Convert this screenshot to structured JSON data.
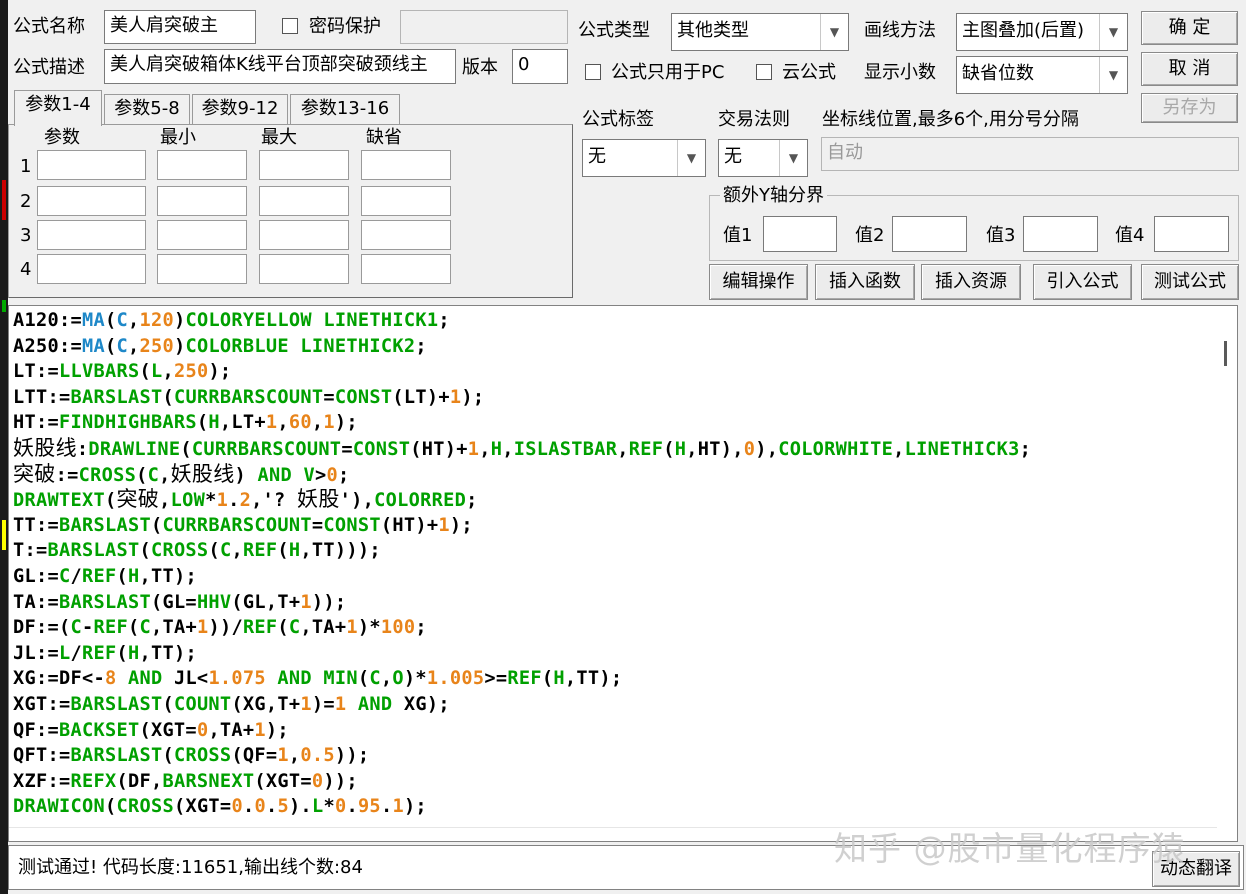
{
  "labels": {
    "formula_name": "公式名称",
    "password_protect": "密码保护",
    "formula_desc": "公式描述",
    "version": "版本",
    "formula_type": "公式类型",
    "draw_method": "画线方法",
    "pc_only": "公式只用于PC",
    "cloud_formula": "云公式",
    "show_decimal": "显示小数",
    "formula_tag": "公式标签",
    "trade_rule": "交易法则",
    "coord_position": "坐标线位置,最多6个,用分号分隔",
    "extra_y_axis": "额外Y轴分界",
    "val1": "值1",
    "val2": "值2",
    "val3": "值3",
    "val4": "值4"
  },
  "fields": {
    "formula_name": "美人肩突破主",
    "password": "",
    "formula_desc": "美人肩突破箱体K线平台顶部突破颈线主",
    "version": "0",
    "formula_type": "其他类型",
    "draw_method": "主图叠加(后置)",
    "decimal_places": "缺省位数",
    "formula_tag": "无",
    "trade_rule": "无",
    "coord_position": "自动"
  },
  "buttons": {
    "ok": "确  定",
    "cancel": "取  消",
    "save_as": "另存为",
    "edit_ops": "编辑操作",
    "insert_func": "插入函数",
    "insert_resource": "插入资源",
    "import_formula": "引入公式",
    "test_formula": "测试公式",
    "dynamic_translate": "动态翻译"
  },
  "tabs": [
    "参数1-4",
    "参数5-8",
    "参数9-12",
    "参数13-16"
  ],
  "param_headers": [
    "参数",
    "最小",
    "最大",
    "缺省"
  ],
  "param_rows": [
    "1",
    "2",
    "3",
    "4"
  ],
  "code_lines": [
    [
      [
        "k",
        "A120:="
      ],
      [
        "b",
        "MA"
      ],
      [
        "k",
        "("
      ],
      [
        "b",
        "C"
      ],
      [
        "k",
        ","
      ],
      [
        "o",
        "120"
      ],
      [
        "k",
        ")"
      ],
      [
        "f",
        "COLORYELLOW LINETHICK1"
      ],
      [
        "k",
        ";"
      ]
    ],
    [
      [
        "k",
        "A250:="
      ],
      [
        "b",
        "MA"
      ],
      [
        "k",
        "("
      ],
      [
        "b",
        "C"
      ],
      [
        "k",
        ","
      ],
      [
        "o",
        "250"
      ],
      [
        "k",
        ")"
      ],
      [
        "f",
        "COLORBLUE LINETHICK2"
      ],
      [
        "k",
        ";"
      ]
    ],
    [
      [
        "k",
        "LT:="
      ],
      [
        "f",
        "LLVBARS"
      ],
      [
        "k",
        "("
      ],
      [
        "f",
        "L"
      ],
      [
        "k",
        ","
      ],
      [
        "o",
        "250"
      ],
      [
        "k",
        ");"
      ]
    ],
    [
      [
        "k",
        "LTT:="
      ],
      [
        "f",
        "BARSLAST"
      ],
      [
        "k",
        "("
      ],
      [
        "f",
        "CURRBARSCOUNT"
      ],
      [
        "k",
        "="
      ],
      [
        "f",
        "CONST"
      ],
      [
        "k",
        "(LT)+"
      ],
      [
        "o",
        "1"
      ],
      [
        "k",
        ");"
      ]
    ],
    [
      [
        "k",
        "HT:="
      ],
      [
        "f",
        "FINDHIGHBARS"
      ],
      [
        "k",
        "("
      ],
      [
        "f",
        "H"
      ],
      [
        "k",
        ",LT+"
      ],
      [
        "o",
        "1"
      ],
      [
        "k",
        ","
      ],
      [
        "o",
        "60"
      ],
      [
        "k",
        ","
      ],
      [
        "o",
        "1"
      ],
      [
        "k",
        ");"
      ]
    ],
    [
      [
        "c",
        "妖股线"
      ],
      [
        "k",
        ":"
      ],
      [
        "f",
        "DRAWLINE"
      ],
      [
        "k",
        "("
      ],
      [
        "f",
        "CURRBARSCOUNT"
      ],
      [
        "k",
        "="
      ],
      [
        "f",
        "CONST"
      ],
      [
        "k",
        "(HT)+"
      ],
      [
        "o",
        "1"
      ],
      [
        "k",
        ","
      ],
      [
        "f",
        "H"
      ],
      [
        "k",
        ","
      ],
      [
        "f",
        "ISLASTBAR"
      ],
      [
        "k",
        ","
      ],
      [
        "f",
        "REF"
      ],
      [
        "k",
        "("
      ],
      [
        "f",
        "H"
      ],
      [
        "k",
        ",HT),"
      ],
      [
        "o",
        "0"
      ],
      [
        "k",
        "),"
      ],
      [
        "f",
        "COLORWHITE"
      ],
      [
        "k",
        ","
      ],
      [
        "f",
        "LINETHICK3"
      ],
      [
        "k",
        ";"
      ]
    ],
    [
      [
        "c",
        "突破"
      ],
      [
        "k",
        ":="
      ],
      [
        "f",
        "CROSS"
      ],
      [
        "k",
        "("
      ],
      [
        "f",
        "C"
      ],
      [
        "k",
        ","
      ],
      [
        "c",
        "妖股线"
      ],
      [
        "k",
        ") "
      ],
      [
        "f",
        "AND"
      ],
      [
        "k",
        " "
      ],
      [
        "f",
        "V"
      ],
      [
        "k",
        ">"
      ],
      [
        "o",
        "0"
      ],
      [
        "k",
        ";"
      ]
    ],
    [
      [
        "f",
        "DRAWTEXT"
      ],
      [
        "k",
        "("
      ],
      [
        "c",
        "突破"
      ],
      [
        "k",
        ","
      ],
      [
        "f",
        "LOW"
      ],
      [
        "k",
        "*"
      ],
      [
        "o",
        "1"
      ],
      [
        "k",
        "."
      ],
      [
        "o",
        "2"
      ],
      [
        "k",
        ",'? "
      ],
      [
        "c",
        "妖股"
      ],
      [
        "k",
        "'),"
      ],
      [
        "f",
        "COLORRED"
      ],
      [
        "k",
        ";"
      ]
    ],
    [
      [
        "k",
        "TT:="
      ],
      [
        "f",
        "BARSLAST"
      ],
      [
        "k",
        "("
      ],
      [
        "f",
        "CURRBARSCOUNT"
      ],
      [
        "k",
        "="
      ],
      [
        "f",
        "CONST"
      ],
      [
        "k",
        "(HT)+"
      ],
      [
        "o",
        "1"
      ],
      [
        "k",
        ");"
      ]
    ],
    [
      [
        "k",
        "T:="
      ],
      [
        "f",
        "BARSLAST"
      ],
      [
        "k",
        "("
      ],
      [
        "f",
        "CROSS"
      ],
      [
        "k",
        "("
      ],
      [
        "f",
        "C"
      ],
      [
        "k",
        ","
      ],
      [
        "f",
        "REF"
      ],
      [
        "k",
        "("
      ],
      [
        "f",
        "H"
      ],
      [
        "k",
        ",TT)));"
      ]
    ],
    [
      [
        "k",
        "GL:="
      ],
      [
        "f",
        "C"
      ],
      [
        "k",
        "/"
      ],
      [
        "f",
        "REF"
      ],
      [
        "k",
        "("
      ],
      [
        "f",
        "H"
      ],
      [
        "k",
        ",TT);"
      ]
    ],
    [
      [
        "k",
        "TA:="
      ],
      [
        "f",
        "BARSLAST"
      ],
      [
        "k",
        "(GL="
      ],
      [
        "f",
        "HHV"
      ],
      [
        "k",
        "(GL,T+"
      ],
      [
        "o",
        "1"
      ],
      [
        "k",
        "));"
      ]
    ],
    [
      [
        "k",
        "DF:=("
      ],
      [
        "f",
        "C"
      ],
      [
        "k",
        "-"
      ],
      [
        "f",
        "REF"
      ],
      [
        "k",
        "("
      ],
      [
        "f",
        "C"
      ],
      [
        "k",
        ",TA+"
      ],
      [
        "o",
        "1"
      ],
      [
        "k",
        "))/"
      ],
      [
        "f",
        "REF"
      ],
      [
        "k",
        "("
      ],
      [
        "f",
        "C"
      ],
      [
        "k",
        ",TA+"
      ],
      [
        "o",
        "1"
      ],
      [
        "k",
        ")*"
      ],
      [
        "o",
        "100"
      ],
      [
        "k",
        ";"
      ]
    ],
    [
      [
        "k",
        "JL:="
      ],
      [
        "f",
        "L"
      ],
      [
        "k",
        "/"
      ],
      [
        "f",
        "REF"
      ],
      [
        "k",
        "("
      ],
      [
        "f",
        "H"
      ],
      [
        "k",
        ",TT);"
      ]
    ],
    [
      [
        "k",
        "XG:=DF<-"
      ],
      [
        "o",
        "8"
      ],
      [
        "k",
        " "
      ],
      [
        "f",
        "AND"
      ],
      [
        "k",
        " JL<"
      ],
      [
        "o",
        "1.075"
      ],
      [
        "k",
        " "
      ],
      [
        "f",
        "AND"
      ],
      [
        "k",
        " "
      ],
      [
        "f",
        "MIN"
      ],
      [
        "k",
        "("
      ],
      [
        "f",
        "C"
      ],
      [
        "k",
        ","
      ],
      [
        "f",
        "O"
      ],
      [
        "k",
        ")*"
      ],
      [
        "o",
        "1.005"
      ],
      [
        "k",
        ">="
      ],
      [
        "f",
        "REF"
      ],
      [
        "k",
        "("
      ],
      [
        "f",
        "H"
      ],
      [
        "k",
        ",TT);"
      ]
    ],
    [
      [
        "k",
        "XGT:="
      ],
      [
        "f",
        "BARSLAST"
      ],
      [
        "k",
        "("
      ],
      [
        "f",
        "COUNT"
      ],
      [
        "k",
        "(XG,T+"
      ],
      [
        "o",
        "1"
      ],
      [
        "k",
        ")="
      ],
      [
        "o",
        "1"
      ],
      [
        "k",
        " "
      ],
      [
        "f",
        "AND"
      ],
      [
        "k",
        " XG);"
      ]
    ],
    [
      [
        "k",
        "QF:="
      ],
      [
        "f",
        "BACKSET"
      ],
      [
        "k",
        "(XGT="
      ],
      [
        "o",
        "0"
      ],
      [
        "k",
        ",TA+"
      ],
      [
        "o",
        "1"
      ],
      [
        "k",
        ");"
      ]
    ],
    [
      [
        "k",
        "QFT:="
      ],
      [
        "f",
        "BARSLAST"
      ],
      [
        "k",
        "("
      ],
      [
        "f",
        "CROSS"
      ],
      [
        "k",
        "(QF="
      ],
      [
        "o",
        "1"
      ],
      [
        "k",
        ","
      ],
      [
        "o",
        "0.5"
      ],
      [
        "k",
        "));"
      ]
    ],
    [
      [
        "k",
        "XZF:="
      ],
      [
        "f",
        "REFX"
      ],
      [
        "k",
        "(DF,"
      ],
      [
        "f",
        "BARSNEXT"
      ],
      [
        "k",
        "(XGT="
      ],
      [
        "o",
        "0"
      ],
      [
        "k",
        "));"
      ]
    ],
    [
      [
        "f",
        "DRAWICON"
      ],
      [
        "k",
        "("
      ],
      [
        "f",
        "CROSS"
      ],
      [
        "k",
        "(XGT="
      ],
      [
        "o",
        "0"
      ],
      [
        "k",
        "."
      ],
      [
        "o",
        "0"
      ],
      [
        "k",
        "."
      ],
      [
        "o",
        "5"
      ],
      [
        "k",
        ")."
      ],
      [
        "f",
        "L"
      ],
      [
        "k",
        "*"
      ],
      [
        "o",
        "0"
      ],
      [
        "k",
        "."
      ],
      [
        "o",
        "95"
      ],
      [
        "k",
        "."
      ],
      [
        "o",
        "1"
      ],
      [
        "k",
        ");"
      ]
    ]
  ],
  "status_text": "测试通过! 代码长度:11651,输出线个数:84",
  "watermark": "知乎 @股市量化程序猿",
  "colors": {
    "keyword": "#000000",
    "function": "#00a000",
    "builtin": "#1e88c8",
    "number": "#e8841a"
  }
}
